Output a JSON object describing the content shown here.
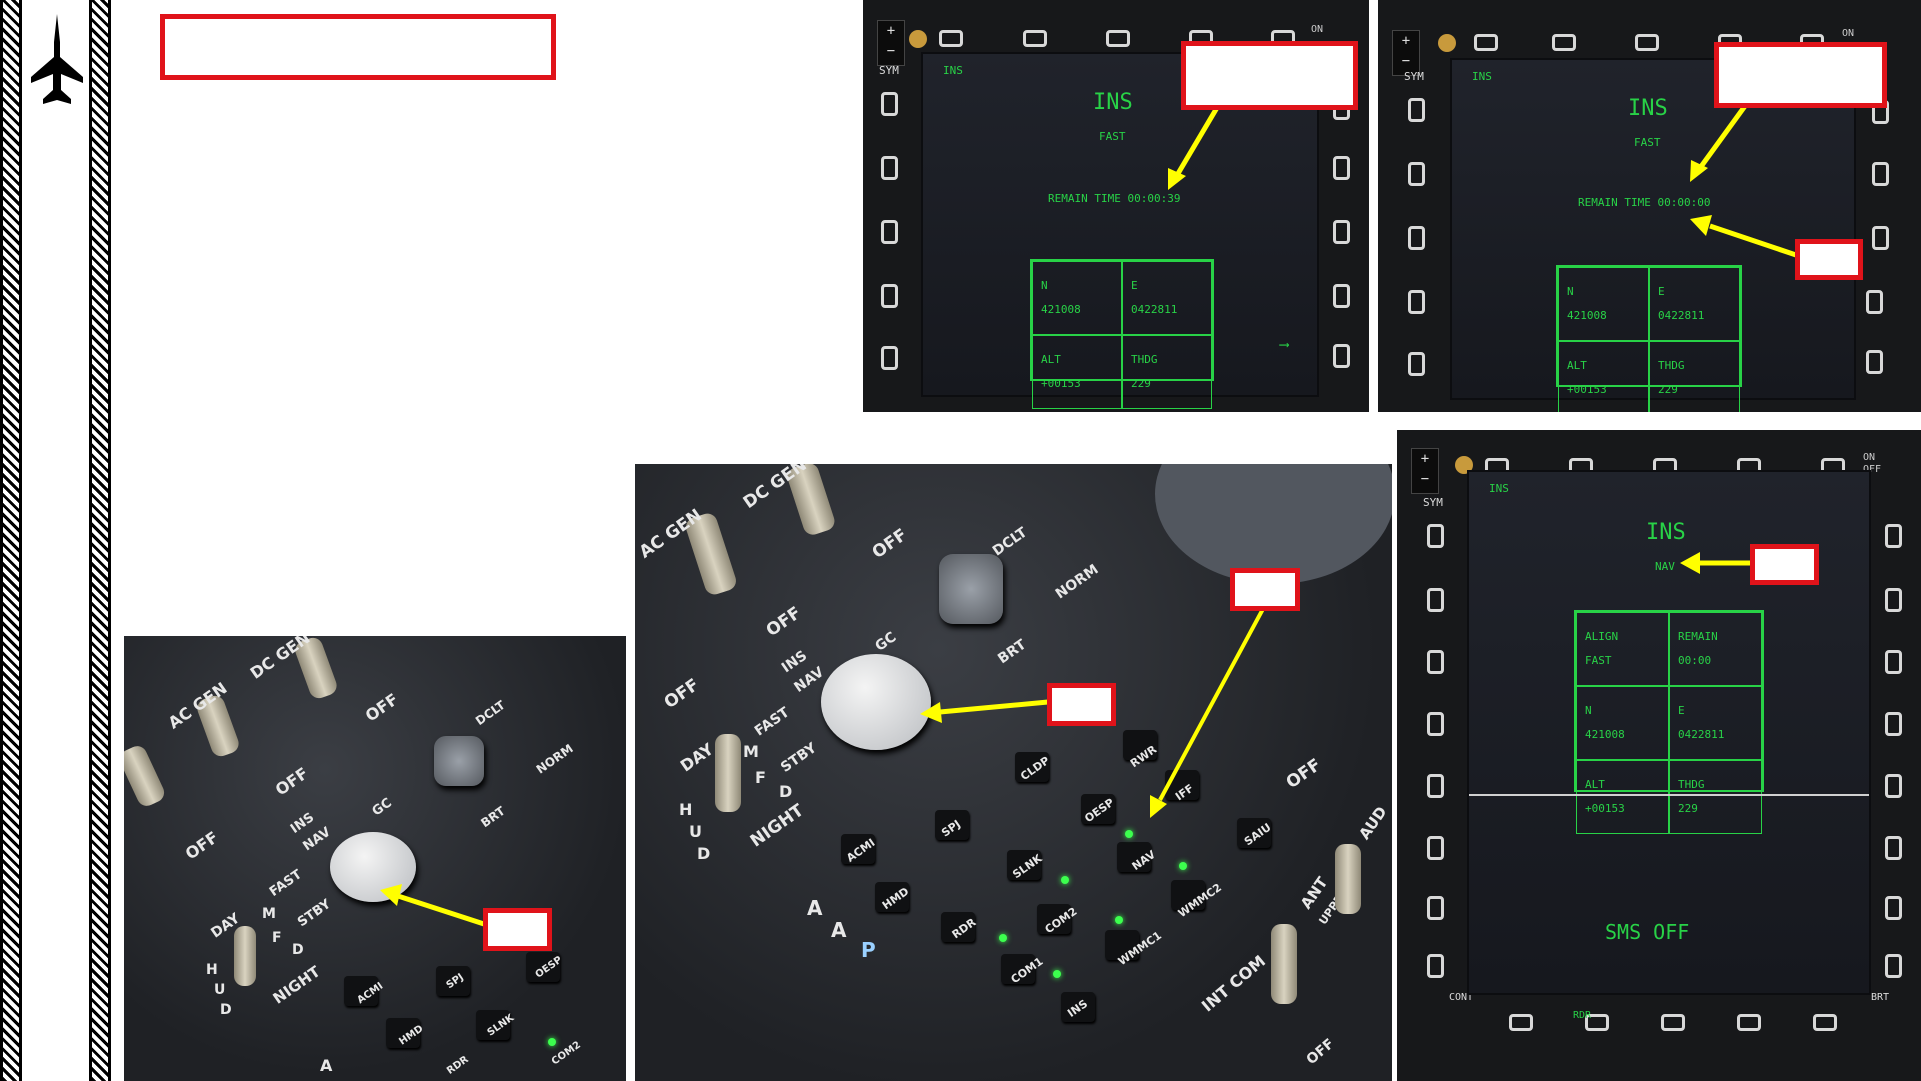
{
  "sidebar": {
    "aircraft_icon": "jet-silhouette-icon"
  },
  "colors": {
    "callout_border": "#e0131a",
    "arrow": "#ffff00",
    "mfd_text": "#28d247"
  },
  "mfd_fast_39": {
    "mode": "INS",
    "page_title": "INS",
    "sub": "FAST",
    "remain": "REMAIN TIME 00:00:39",
    "osb_sym": "SYM",
    "osb_on": "ON",
    "cells": [
      {
        "label": "N",
        "value": "421008"
      },
      {
        "label": "E",
        "value": "0422811"
      },
      {
        "label": "ALT",
        "value": "+00153"
      },
      {
        "label": "THDG",
        "value": "229"
      }
    ]
  },
  "mfd_fast_00": {
    "mode": "INS",
    "page_title": "INS",
    "sub": "FAST",
    "remain": "REMAIN TIME 00:00:00",
    "osb_sym": "SYM",
    "osb_on": "ON",
    "cells": [
      {
        "label": "N",
        "value": "421008"
      },
      {
        "label": "E",
        "value": "0422811"
      },
      {
        "label": "ALT",
        "value": "+00153"
      },
      {
        "label": "THDG",
        "value": "229"
      }
    ]
  },
  "mfd_nav": {
    "mode": "INS",
    "page_title": "INS",
    "sub": "NAV",
    "osb_sym": "SYM",
    "osb_on": "ON",
    "osb_off": "OFF",
    "cont": "CONT",
    "brt": "BRT",
    "rdr": "RDR",
    "cells": [
      {
        "label": "ALIGN",
        "value": "FAST"
      },
      {
        "label": "REMAIN",
        "value": "00:00"
      },
      {
        "label": "N",
        "value": "421008"
      },
      {
        "label": "E",
        "value": "0422811"
      },
      {
        "label": "ALT",
        "value": "+00153"
      },
      {
        "label": "THDG",
        "value": "229"
      }
    ],
    "sms": "SMS OFF"
  },
  "panel_small": {
    "labels": [
      "AC GEN",
      "DC GEN",
      "OFF",
      "OFF",
      "OFF",
      "INS",
      "NAV",
      "GC",
      "FAST",
      "STBY",
      "DAY",
      "M",
      "F",
      "D",
      "H",
      "U",
      "D",
      "NIGHT",
      "DCLT",
      "BRT",
      "NORM",
      "ACMI",
      "SPJ",
      "OESP",
      "HMD",
      "SLNK",
      "COM2",
      "RDR",
      "A"
    ]
  },
  "panel_large": {
    "labels": [
      "AC GEN",
      "DC GEN",
      "OFF",
      "OFF",
      "OFF",
      "INS",
      "NAV",
      "GC",
      "FAST",
      "STBY",
      "DAY",
      "M",
      "F",
      "D",
      "H",
      "U",
      "D",
      "NIGHT",
      "DCLT",
      "BRT",
      "NORM",
      "OFF",
      "CLDP",
      "OESP",
      "RWR",
      "IFF",
      "SAIU",
      "ACMI",
      "SPJ",
      "SLNK",
      "NAV",
      "WMMC2",
      "HMD",
      "RDR",
      "COM2",
      "WMMC1",
      "COM1",
      "INS",
      "ANT",
      "UPPER",
      "INT COM",
      "AUD",
      "OFF",
      "A",
      "A",
      "P"
    ]
  }
}
